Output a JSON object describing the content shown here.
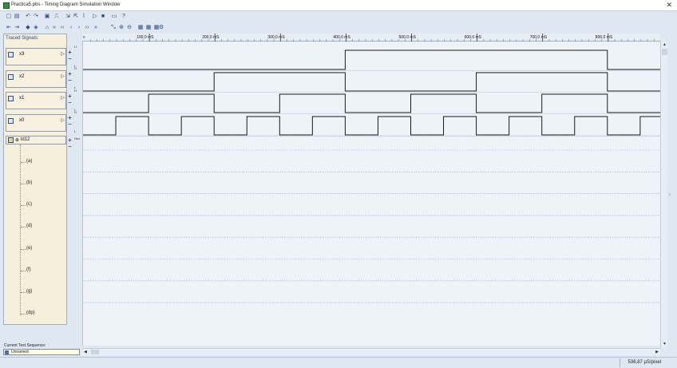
{
  "window": {
    "title": "Practica5.pbs - Timing Diagram Simulation Window",
    "close_icon": "close-icon"
  },
  "toolbar1": [
    {
      "name": "new-file-icon",
      "glyph": "▢"
    },
    {
      "name": "open-file-icon",
      "glyph": "▤"
    },
    {
      "name": "undo-icon",
      "glyph": "↶"
    },
    {
      "name": "redo-icon",
      "glyph": "↷"
    },
    {
      "name": "save-icon",
      "glyph": "▣"
    },
    {
      "name": "clock-wave-icon",
      "glyph": "⎍"
    },
    {
      "name": "add-signal-icon",
      "glyph": "⇲"
    },
    {
      "name": "edit-signal-icon",
      "glyph": "⇱"
    },
    {
      "name": "waveform-icon",
      "glyph": "⌇"
    },
    {
      "name": "run-icon",
      "glyph": "▷"
    },
    {
      "name": "stop-icon",
      "glyph": "■"
    },
    {
      "name": "window-icon",
      "glyph": "▭"
    },
    {
      "name": "help-icon",
      "glyph": "?"
    }
  ],
  "toolbar2": [
    {
      "name": "step-in-icon",
      "glyph": "⇤"
    },
    {
      "name": "step-out-icon",
      "glyph": "⇥"
    },
    {
      "name": "insert-icon",
      "glyph": "◆"
    },
    {
      "name": "delete-icon",
      "glyph": "◈"
    },
    {
      "name": "marker-icon",
      "glyph": "⌂"
    },
    {
      "name": "first-icon",
      "glyph": "«"
    },
    {
      "name": "prev-page-icon",
      "glyph": "‹‹"
    },
    {
      "name": "prev-icon",
      "glyph": "‹"
    },
    {
      "name": "next-icon",
      "glyph": "›"
    },
    {
      "name": "next-page-icon",
      "glyph": "››"
    },
    {
      "name": "last-icon",
      "glyph": "»"
    },
    {
      "name": "zoom-fit-icon",
      "glyph": "⤡"
    },
    {
      "name": "zoom-in-icon",
      "glyph": "⊕"
    },
    {
      "name": "zoom-out-icon",
      "glyph": "⊖"
    },
    {
      "name": "grid-a-icon",
      "glyph": "▦"
    },
    {
      "name": "grid-b-icon",
      "glyph": "▦"
    },
    {
      "name": "grid-c-icon",
      "glyph": "▦"
    },
    {
      "name": "settings-icon",
      "glyph": "⚙"
    }
  ],
  "traced": {
    "label": "Traced Signals:",
    "signals": [
      {
        "name": "x3",
        "wave": [
          0,
          0,
          0,
          0,
          1,
          1,
          1,
          1,
          0
        ]
      },
      {
        "name": "x2",
        "wave": [
          0,
          0,
          1,
          1,
          0,
          0,
          1,
          1,
          0
        ]
      },
      {
        "name": "x1",
        "wave": [
          0,
          1,
          0,
          1,
          0,
          1,
          0,
          1,
          0
        ]
      },
      {
        "name": "x0",
        "wave": [
          0,
          1,
          0,
          1,
          0,
          1,
          0,
          1,
          0,
          1,
          0,
          1,
          0,
          1,
          0,
          1,
          0,
          1
        ]
      }
    ],
    "bus": {
      "name": "ld12",
      "glyph": "⊕"
    },
    "segments": [
      "(a)",
      "(b)",
      "(c)",
      "(d)",
      "(e)",
      "(f)",
      "(g)",
      "(dp)"
    ]
  },
  "handles": {
    "plus": "+",
    "minus": "−",
    "h": "H",
    "l": "L",
    "hex": "Hex"
  },
  "ruler": {
    "origin": "0",
    "ticks": [
      "100,0 mS",
      "200,0 mS",
      "300,0 mS",
      "400,0 mS",
      "500,0 mS",
      "600,0 mS",
      "700,0 mS",
      "800,0 mS"
    ]
  },
  "current_test": {
    "label": "Current Test Sequence:",
    "value": "Unnamed"
  },
  "status": {
    "resolution": "536,87 µS/pixel"
  },
  "colors": {
    "wave": "#1a1a1a",
    "grid": "#9aa7b8",
    "ruler_bg": "#e8eef5"
  }
}
